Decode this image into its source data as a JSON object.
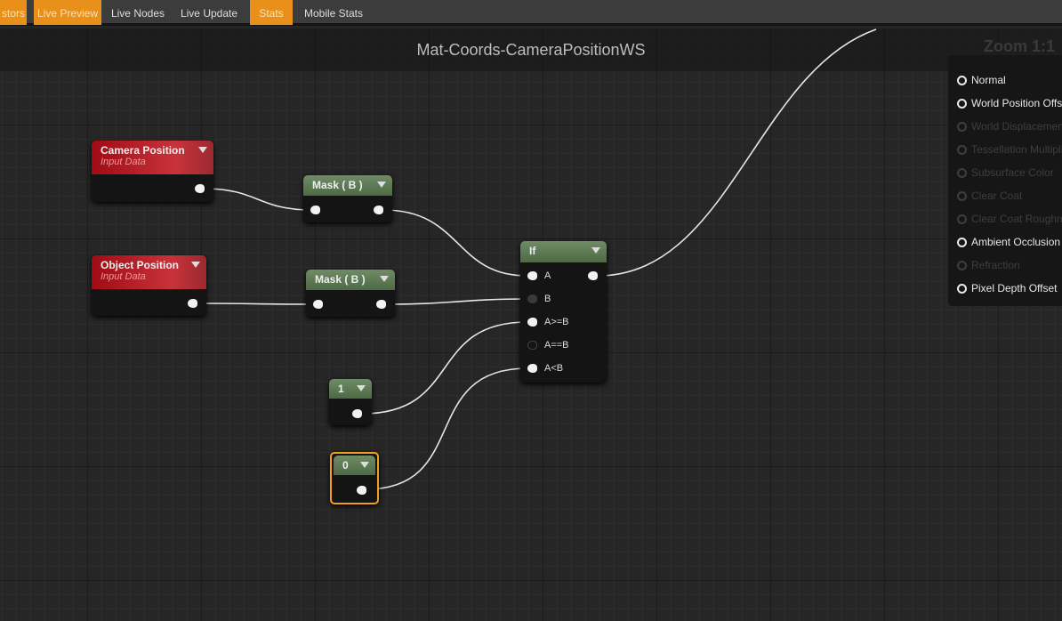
{
  "toolbar": {
    "items": [
      {
        "label": "stors",
        "active": true
      },
      {
        "label": "Live Preview",
        "active": true
      },
      {
        "label": "Live Nodes",
        "active": false
      },
      {
        "label": "Live Update",
        "active": false
      },
      {
        "label": "Stats",
        "active": true
      },
      {
        "label": "Mobile Stats",
        "active": false
      }
    ],
    "accent": "#e8901a"
  },
  "graph": {
    "title": "Mat-Coords-CameraPositionWS",
    "zoom": "Zoom 1:1"
  },
  "nodes": {
    "camera": {
      "title": "Camera Position",
      "subtitle": "Input Data"
    },
    "object": {
      "title": "Object Position",
      "subtitle": "Input Data"
    },
    "mask1": {
      "title": "Mask ( B )"
    },
    "mask2": {
      "title": "Mask ( B )"
    },
    "if": {
      "title": "If",
      "pins": [
        "A",
        "B",
        "A>=B",
        "A==B",
        "A<B"
      ]
    },
    "const1": {
      "title": "1"
    },
    "const0": {
      "title": "0"
    }
  },
  "material_inputs": [
    {
      "label": "Normal",
      "enabled": true
    },
    {
      "label": "World Position Offset",
      "enabled": true
    },
    {
      "label": "World Displacement",
      "enabled": false
    },
    {
      "label": "Tessellation Multiplier",
      "enabled": false
    },
    {
      "label": "Subsurface Color",
      "enabled": false
    },
    {
      "label": "Clear Coat",
      "enabled": false
    },
    {
      "label": "Clear Coat Roughness",
      "enabled": false
    },
    {
      "label": "Ambient Occlusion",
      "enabled": true
    },
    {
      "label": "Refraction",
      "enabled": false
    },
    {
      "label": "Pixel Depth Offset",
      "enabled": true
    }
  ]
}
